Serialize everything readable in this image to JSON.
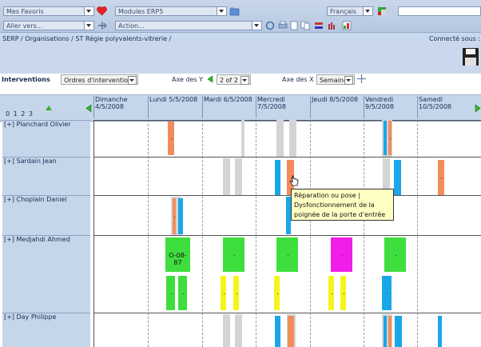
{
  "toolbar": {
    "favorites": "Mes Favoris",
    "goto": "Aller vers...",
    "modules": "Modules ERP5",
    "action": "Action...",
    "language": "Français"
  },
  "breadcrumb": "SERP / Organisations / ST Régie polyvalents-vitrerie /",
  "connected_as": "Connecté sous : t",
  "controls": {
    "section_title": "Interventions",
    "listbox": "Ordres d'intervention",
    "axis_y_label": "Axe des Y",
    "axis_y_value": "2 of 2",
    "axis_x_label": "Axe des X",
    "axis_x_value": "Semaine"
  },
  "depth_levels": "0 1 2 3",
  "days": [
    {
      "name": "Dimanche",
      "date": "4/5/2008"
    },
    {
      "name": "Lundi 5/5/2008",
      "date": ""
    },
    {
      "name": "Mardi 6/5/2008",
      "date": ""
    },
    {
      "name": "Mercredi",
      "date": "7/5/2008"
    },
    {
      "name": "Jeudi 8/5/2008",
      "date": ""
    },
    {
      "name": "Vendredi",
      "date": "9/5/2008"
    },
    {
      "name": "Samedi",
      "date": "10/5/2008"
    }
  ],
  "people": [
    {
      "name": "[+] Planchard Olivier"
    },
    {
      "name": "[+] Sardain Jean"
    },
    {
      "name": "[+] Choplain Daniel"
    },
    {
      "name": "[+] Medjahdi Ahmed"
    },
    {
      "name": "[+] Day Philippe"
    }
  ],
  "block_label": "O-08-87",
  "tooltip": {
    "line1": "Réparation ou pose |",
    "line2": "Dysfonctionnement de la",
    "line3": "poignée de la porte d'entrée"
  },
  "colors": {
    "orange": "#f28c5a",
    "blue": "#1aa7e8",
    "grey": "#d4d4d4",
    "green": "#3fde3f",
    "yellow": "#f5f51a",
    "magenta": "#f01ee8"
  }
}
